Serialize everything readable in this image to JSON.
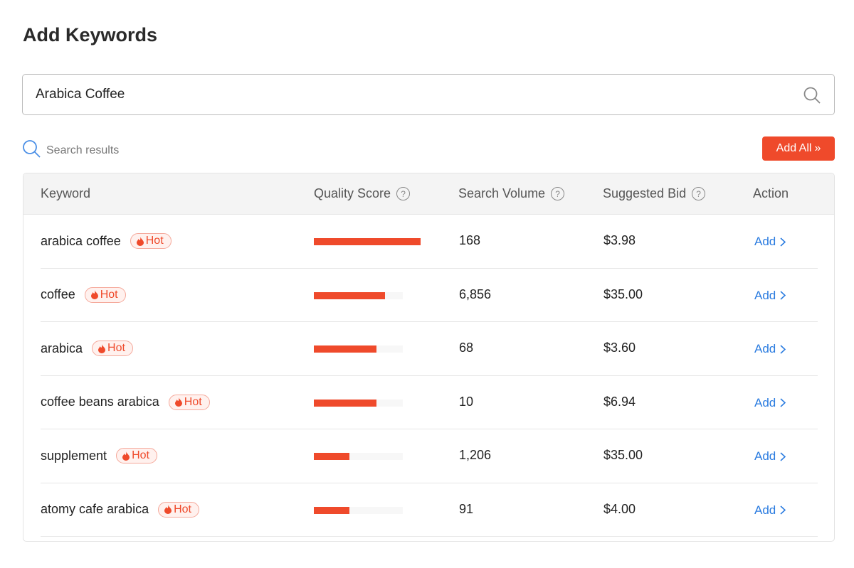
{
  "title": "Add Keywords",
  "search": {
    "value": "Arabica Coffee",
    "icon": "search-icon"
  },
  "results_label": "Search results",
  "add_all_label": "Add All",
  "accent": "#ef4a2b",
  "link_color": "#2b7ce0",
  "columns": {
    "keyword": "Keyword",
    "quality": "Quality Score",
    "volume": "Search Volume",
    "bid": "Suggested Bid",
    "action": "Action",
    "help": "?"
  },
  "rows": [
    {
      "keyword": "arabica coffee",
      "badge": "Hot",
      "quality": 1.0,
      "volume": "168",
      "bid": "$3.98",
      "action": "Add"
    },
    {
      "keyword": "coffee",
      "badge": "Hot",
      "quality": 0.8,
      "volume": "6,856",
      "bid": "$35.00",
      "action": "Add"
    },
    {
      "keyword": "arabica",
      "badge": "Hot",
      "quality": 0.7,
      "volume": "68",
      "bid": "$3.60",
      "action": "Add"
    },
    {
      "keyword": "coffee beans arabica",
      "badge": "Hot",
      "quality": 0.7,
      "volume": "10",
      "bid": "$6.94",
      "action": "Add"
    },
    {
      "keyword": "supplement",
      "badge": "Hot",
      "quality": 0.4,
      "volume": "1,206",
      "bid": "$35.00",
      "action": "Add"
    },
    {
      "keyword": "atomy cafe arabica",
      "badge": "Hot",
      "quality": 0.4,
      "volume": "91",
      "bid": "$4.00",
      "action": "Add"
    }
  ]
}
